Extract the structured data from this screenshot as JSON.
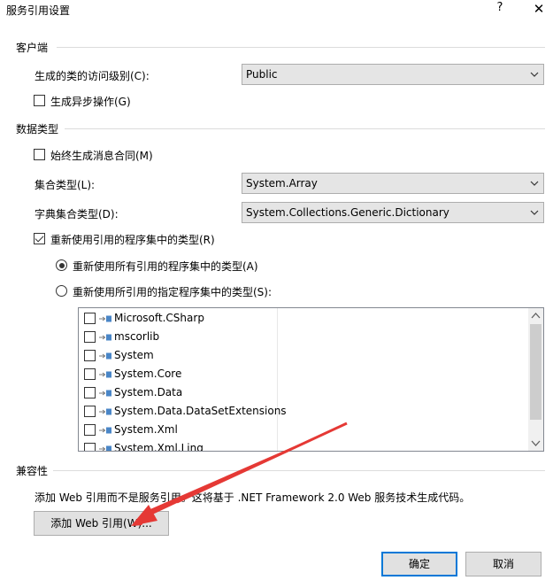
{
  "window": {
    "title": "服务引用设置",
    "help": "?",
    "close": "✕"
  },
  "client": {
    "group_title": "客户端",
    "access_level_label": "生成的类的访问级别(C):",
    "access_level_value": "Public",
    "async_label": "生成异步操作(G)",
    "async_checked": false
  },
  "data_type": {
    "group_title": "数据类型",
    "always_generate_label": "始终生成消息合同(M)",
    "always_generate_checked": false,
    "collection_label": "集合类型(L):",
    "collection_value": "System.Array",
    "dictionary_label": "字典集合类型(D):",
    "dictionary_value": "System.Collections.Generic.Dictionary",
    "reuse_label": "重新使用引用的程序集中的类型(R)",
    "reuse_checked": true,
    "reuse_all_label": "重新使用所有引用的程序集中的类型(A)",
    "reuse_all_selected": true,
    "reuse_specified_label": "重新使用所引用的指定程序集中的类型(S):",
    "reuse_specified_selected": false,
    "assemblies": [
      {
        "name": "Microsoft.CSharp",
        "checked": false
      },
      {
        "name": "mscorlib",
        "checked": false
      },
      {
        "name": "System",
        "checked": false
      },
      {
        "name": "System.Core",
        "checked": false
      },
      {
        "name": "System.Data",
        "checked": false
      },
      {
        "name": "System.Data.DataSetExtensions",
        "checked": false
      },
      {
        "name": "System.Xml",
        "checked": false
      },
      {
        "name": "System.Xml.Linq",
        "checked": false
      }
    ]
  },
  "compat": {
    "group_title": "兼容性",
    "description": "添加 Web 引用而不是服务引用。这将基于 .NET Framework 2.0 Web 服务技术生成代码。",
    "add_web_ref_button": "添加 Web 引用(W)..."
  },
  "footer": {
    "ok_button": "确定",
    "cancel_button": "取消"
  },
  "colors": {
    "default_button_border": "#0078d7",
    "annotation_arrow": "#e53935"
  },
  "icons": {
    "dropdown": "chevron-down-icon",
    "assembly": "assembly-icon",
    "help": "help-icon",
    "close": "close-icon",
    "annotation": "red-arrow-annotation"
  }
}
